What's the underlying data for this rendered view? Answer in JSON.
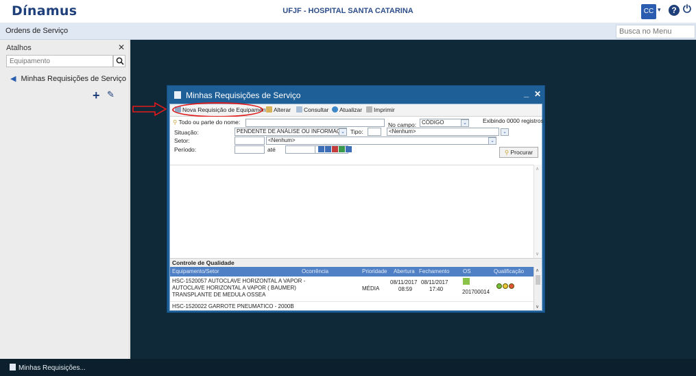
{
  "header": {
    "logo": "Dínamus",
    "title": "UFJF - HOSPITAL SANTA CATARINA",
    "user_initials": "CC"
  },
  "menubar": {
    "module_title": "Ordens de Serviço",
    "search_placeholder": "Busca no Menu"
  },
  "shortcuts": {
    "heading": "Atalhos",
    "search_placeholder": "Equipamento",
    "items": [
      {
        "label": "Minhas Requisições de Serviço"
      }
    ]
  },
  "taskbar": {
    "items": [
      {
        "label": "Minhas Requisições..."
      }
    ]
  },
  "window": {
    "title": "Minhas Requisições de Serviço",
    "toolbar": {
      "new_request": "Nova Requisição de Equipamento",
      "edit": "Alterar",
      "query": "Consultar",
      "refresh": "Atualizar",
      "print": "Imprimir"
    },
    "filters": {
      "name_label": "Todo ou parte do nome:",
      "name_value": "",
      "field_label": "No campo:",
      "field_value": "CÓDIGO",
      "records_info": "Exibindo 0000 registros",
      "status_label": "Situação:",
      "status_value": "PENDENTE DE ANÁLISE OU INFORMAÇÃO",
      "type_label": "Tipo:",
      "type_value": "<Nenhum>",
      "sector_label": "Setor:",
      "sector_value": "<Nenhum>",
      "period_label": "Período:",
      "period_until": "até",
      "search_button": "Procurar"
    },
    "quality": {
      "heading": "Controle de Qualidade",
      "columns": [
        "Equipamento/Setor",
        "Ocorrência",
        "Prioridade",
        "Abertura",
        "Fechamento",
        "OS",
        "Qualificação"
      ],
      "rows": [
        {
          "equipment_line1": "HSC-1520057 AUTOCLAVE HORIZONTAL A VAPOR -",
          "equipment_line2": "AUTOCLAVE HORIZONTAL A VAPOR ( BAUMER)",
          "equipment_line3": "TRANSPLANTE DE MEDULA OSSEA",
          "priority": "MÉDIA",
          "open_date": "08/11/2017",
          "open_time": "08:59",
          "close_date": "08/11/2017",
          "close_time": "17:40",
          "os": "201700014"
        },
        {
          "equipment_line1": "HSC-1520022 GARROTE PNEUMATICO - 2000B"
        }
      ]
    }
  },
  "colors": {
    "desktop": "#0f2938",
    "window_frame": "#1f5f98",
    "grid_header": "#4f7fc4",
    "highlight": "#e01a1a"
  }
}
